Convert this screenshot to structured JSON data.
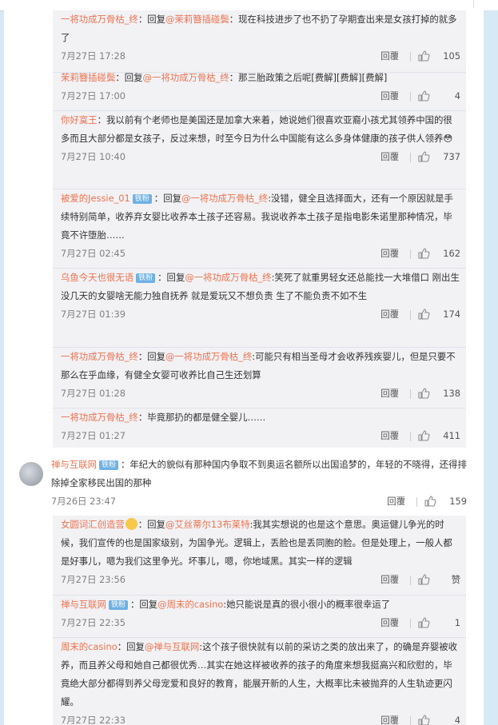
{
  "comments": [
    {
      "pre": "",
      "name": "一将功成万骨枯_终",
      "badge": "",
      "mid": "：回复",
      "at": "@茉莉簪插碰鬓",
      "text": "：现在科技进步了也不扔了孕期查出来是女孩打掉的就多了",
      "time": "7月27日 17:28",
      "reply": "回覆",
      "count": "105"
    },
    {
      "pre": "",
      "name": "茉莉簪插碰鬓",
      "badge": "",
      "mid": "：回复",
      "at": "@一将功成万骨枯_终",
      "text": "：那三胎政策之后呢[费解][费解][费解]",
      "time": "7月27日 17:00",
      "reply": "回覆",
      "count": "4"
    },
    {
      "pre": "",
      "name": "你好寞王",
      "badge": "",
      "mid": "：我以前有个老师也是美国还是加拿大来着，她说她们很喜欢亚裔小孩尤其领养中国的很多而且大部分都是女孩子，反过来想，时至今日为什么中国能有这么多身体健康的孩子供人领养😳",
      "at": "",
      "text": "",
      "time": "7月27日 10:40",
      "reply": "回覆",
      "count": "737"
    },
    {
      "pre": "",
      "name": "被爱的Jessie_01",
      "badge": "铁粉",
      "mid": "：回复",
      "at": "@一将功成万骨枯_终",
      "text": ":没错，健全且选择面大，还有一个原因就是手续特别简单，收养弃女婴比收养本土孩子还容易。我说收养本土孩子是指电影朱诺里那种情况，毕竟不许堕胎……",
      "time": "7月27日 02:45",
      "reply": "回覆",
      "count": "162"
    },
    {
      "pre": "",
      "name": "乌鱼今天也很无语",
      "badge": "铁粉",
      "mid": "：回复",
      "at": "@一将功成万骨枯_终",
      "text": ":笑死了就重男轻女还总能找一大堆借口 刚出生没几天的女婴啥无能力独自抚养 就是爱玩又不想负责 生了不能负责不如不生",
      "time": "7月27日 01:39",
      "reply": "回覆",
      "count": "174"
    },
    {
      "pre": "",
      "name": "一将功成万骨枯_终",
      "badge": "",
      "mid": "：回复",
      "at": "@一将功成万骨枯_终",
      "text": ":可能只有相当圣母才会收养残疾婴儿，但是只要不那么在乎血缘，有健全女婴可收养比自己生还划算",
      "time": "7月27日 01:28",
      "reply": "回覆",
      "count": "138"
    },
    {
      "pre": "",
      "name": "一将功成万骨枯_终",
      "badge": "",
      "mid": "：毕竟那扔的都是健全婴儿……",
      "at": "",
      "text": "",
      "time": "7月27日 01:27",
      "reply": "回覆",
      "count": "411"
    },
    {
      "pre": "",
      "name": "禅与互联网",
      "badge": "铁粉",
      "mid": "：年纪大的貌似有那种国内争取不到奥运名额所以出国追梦的，年轻的不晓得，还得排除掉全家移民出国的那种",
      "at": "",
      "text": "",
      "time": "7月26日 23:47",
      "reply": "回覆",
      "count": "159"
    },
    {
      "pre": "",
      "name": "女圆词汇创造营",
      "badge": "",
      "mid": "：回复",
      "at": "@艾丝蒂尔13布莱特",
      "text": ":我其实想说的也是这个意思。奥运健儿争光的时候，我们宣传的也是国家级别，为国争光。逻辑上，丢脸也是丢同胞的脸。但是处理上，一般人都是好事儿，嗯为我们这里争光。坏事儿，嗯，你地域黑。其实一样的逻辑",
      "time": "7月27日 23:56",
      "reply": "回覆",
      "count": "赞"
    },
    {
      "pre": "",
      "name": "禅与互联网",
      "badge": "铁粉",
      "mid": "：回复",
      "at": "@周末的casino",
      "text": ":她只能说是真的很小很小的概率很幸运了",
      "time": "7月27日 22:35",
      "reply": "回覆",
      "count": "1"
    },
    {
      "pre": "",
      "name": "周末的casino",
      "badge": "",
      "mid": "：回复",
      "at": "@禅与互联网",
      "text": ":这个孩子很快就有以前的采访之类的放出来了，的确是弃婴被收养，而且养父母和她自己都很优秀…其实在她这样被收养的孩子的角度来想我挺高兴和欣慰的，毕竟绝大部分都得到养父母宠爱和良好的教育，能展开新的人生，大概率比未被抛弃的人生轨迹更闪耀。",
      "time": "7月27日 22:33",
      "reply": "回覆",
      "count": "4"
    }
  ],
  "icons": {
    "like": "thumbs-up-icon",
    "avatar": "user-avatar",
    "emoji": "emoji-icon"
  },
  "colors": {
    "name": "#eb7350",
    "badge": "#6eb1e2",
    "block": "#f2f2f5",
    "page": "#d7e9f5"
  }
}
